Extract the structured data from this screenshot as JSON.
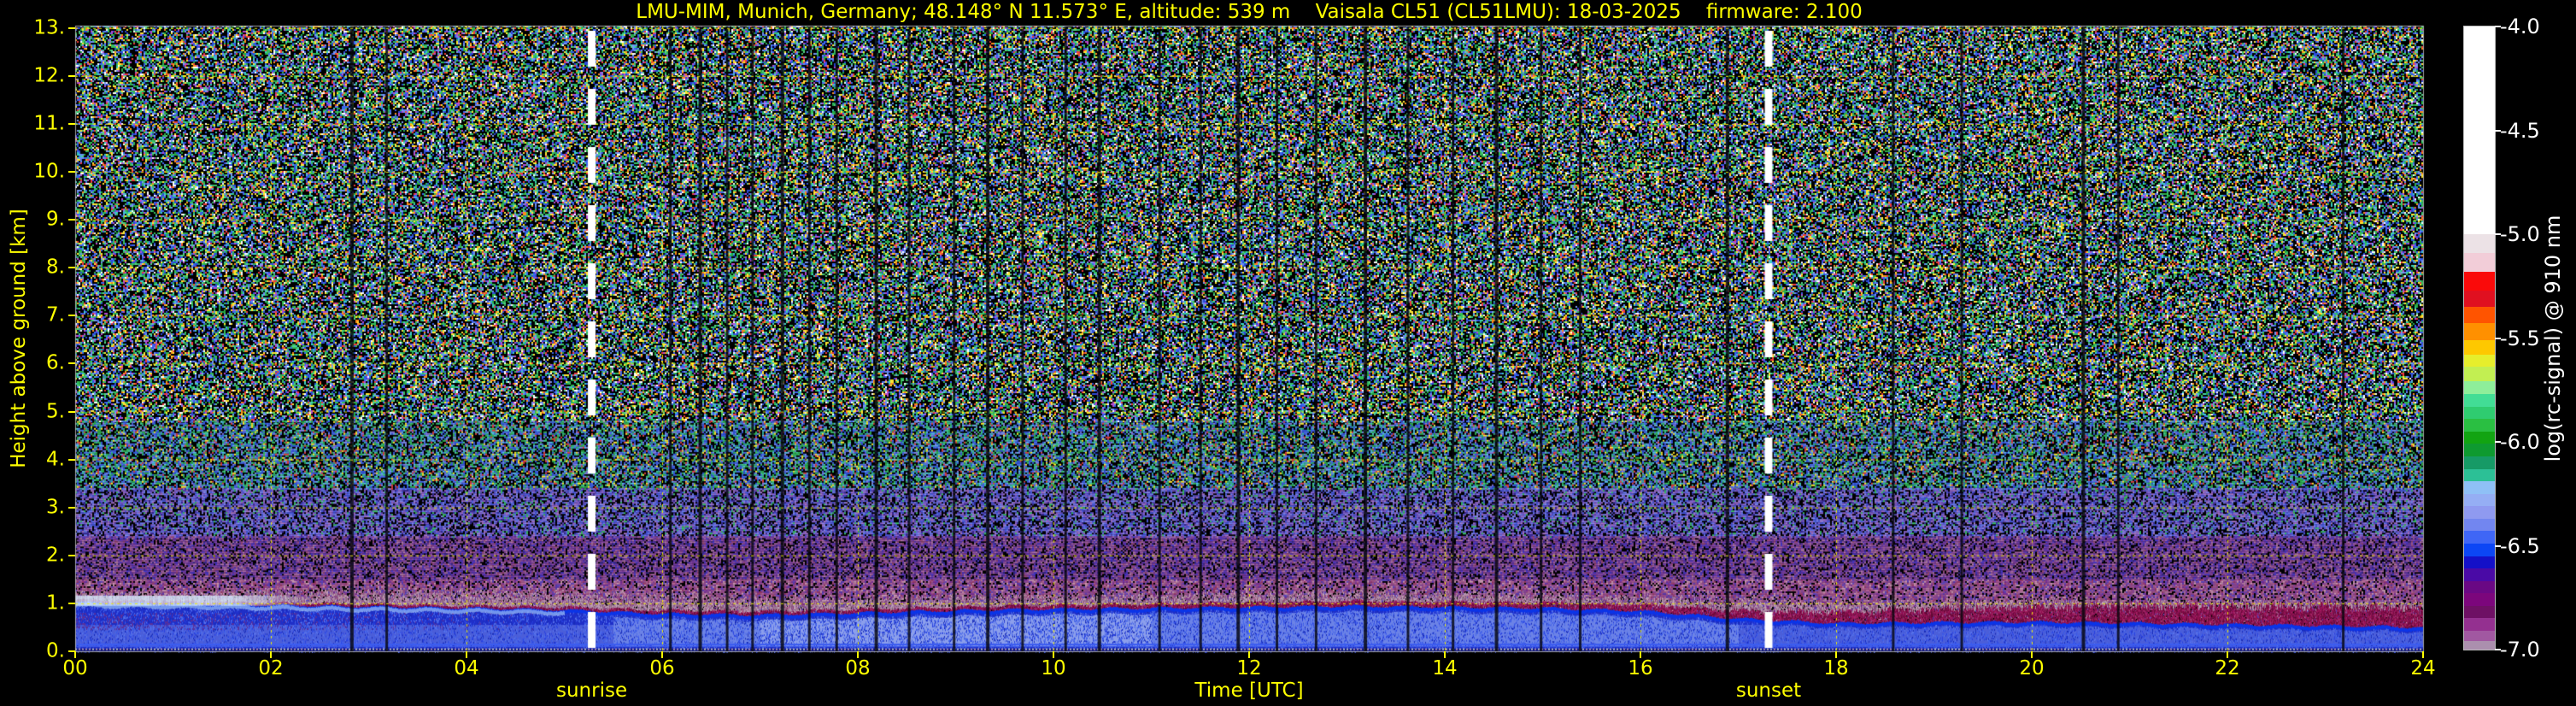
{
  "title": "LMU-MIM, Munich, Germany; 48.148° N 11.573° E, altitude: 539 m    Vaisala CL51 (CL51LMU): 18-03-2025    firmware: 2.100",
  "chart_data": {
    "type": "heatmap",
    "title": "LMU-MIM, Munich, Germany; 48.148° N 11.573° E, altitude: 539 m    Vaisala CL51 (CL51LMU): 18-03-2025    firmware: 2.100",
    "xlabel": "Time [UTC]",
    "ylabel": "Height above ground [km]",
    "colorbar_label": "log(rc-signal) @ 910 nm",
    "x_range_hours": [
      0,
      24
    ],
    "y_range_km": [
      0,
      13.05
    ],
    "x_tick_labels": [
      "00",
      "02",
      "04",
      "06",
      "08",
      "10",
      "12",
      "14",
      "16",
      "18",
      "20",
      "22",
      "24"
    ],
    "x_tick_values": [
      0,
      2,
      4,
      6,
      8,
      10,
      12,
      14,
      16,
      18,
      20,
      22,
      24
    ],
    "y_tick_labels": [
      "0.",
      "1.",
      "2.",
      "3.",
      "4.",
      "5.",
      "6.",
      "7.",
      "8.",
      "9.",
      "10.",
      "11.",
      "12.",
      "13."
    ],
    "y_tick_values": [
      0,
      1,
      2,
      3,
      4,
      5,
      6,
      7,
      8,
      9,
      10,
      11,
      12,
      13
    ],
    "grid": true,
    "gridline_color": "rgba(240,240,0,0.95)",
    "background_color": "#000000",
    "accent_color": "#ffff00",
    "sun_events": {
      "sunrise": {
        "hour": 5.28,
        "label": "sunrise"
      },
      "sunset": {
        "hour": 17.31,
        "label": "sunset"
      },
      "line_color": "#ffffff"
    },
    "colorbar": {
      "min": -7.0,
      "max": -4.0,
      "tick_labels": [
        "-4.0",
        "-4.5",
        "-5.0",
        "-5.5",
        "-6.0",
        "-6.5",
        "-7.0"
      ],
      "tick_values": [
        -4.0,
        -4.5,
        -5.0,
        -5.5,
        -6.0,
        -6.5,
        -7.0
      ],
      "bands": [
        {
          "v0": -4.0,
          "v1": -5.0,
          "color": "#ffffff"
        },
        {
          "v0": -5.0,
          "v1": -5.09,
          "color": "#ece2e6"
        },
        {
          "v0": -5.09,
          "v1": -5.18,
          "color": "#f2cdd8"
        },
        {
          "v0": -5.18,
          "v1": -5.27,
          "color": "#fa0a0a"
        },
        {
          "v0": -5.27,
          "v1": -5.35,
          "color": "#e01020"
        },
        {
          "v0": -5.35,
          "v1": -5.43,
          "color": "#ff5400"
        },
        {
          "v0": -5.43,
          "v1": -5.51,
          "color": "#ff9000"
        },
        {
          "v0": -5.51,
          "v1": -5.58,
          "color": "#fec800"
        },
        {
          "v0": -5.58,
          "v1": -5.64,
          "color": "#e6ee2c"
        },
        {
          "v0": -5.64,
          "v1": -5.71,
          "color": "#c2ef52"
        },
        {
          "v0": -5.71,
          "v1": -5.77,
          "color": "#8eee9a"
        },
        {
          "v0": -5.77,
          "v1": -5.83,
          "color": "#42dd95"
        },
        {
          "v0": -5.83,
          "v1": -5.89,
          "color": "#2fcc70"
        },
        {
          "v0": -5.89,
          "v1": -5.95,
          "color": "#2abf42"
        },
        {
          "v0": -5.95,
          "v1": -6.01,
          "color": "#12a412"
        },
        {
          "v0": -6.01,
          "v1": -6.07,
          "color": "#0e9a30"
        },
        {
          "v0": -6.07,
          "v1": -6.13,
          "color": "#169a66"
        },
        {
          "v0": -6.13,
          "v1": -6.19,
          "color": "#2cc096"
        },
        {
          "v0": -6.19,
          "v1": -6.25,
          "color": "#8fc0f6"
        },
        {
          "v0": -6.25,
          "v1": -6.31,
          "color": "#95aef4"
        },
        {
          "v0": -6.31,
          "v1": -6.37,
          "color": "#8f9af0"
        },
        {
          "v0": -6.37,
          "v1": -6.43,
          "color": "#7286f0"
        },
        {
          "v0": -6.43,
          "v1": -6.49,
          "color": "#3f66f6"
        },
        {
          "v0": -6.49,
          "v1": -6.55,
          "color": "#0c46f5"
        },
        {
          "v0": -6.55,
          "v1": -6.61,
          "color": "#1410c8"
        },
        {
          "v0": -6.61,
          "v1": -6.67,
          "color": "#4a0aa6"
        },
        {
          "v0": -6.67,
          "v1": -6.73,
          "color": "#6a0884"
        },
        {
          "v0": -6.73,
          "v1": -6.79,
          "color": "#7c067c"
        },
        {
          "v0": -6.79,
          "v1": -6.85,
          "color": "#6e1064"
        },
        {
          "v0": -6.85,
          "v1": -6.91,
          "color": "#943090"
        },
        {
          "v0": -6.91,
          "v1": -6.96,
          "color": "#a158a1"
        },
        {
          "v0": -6.96,
          "v1": -7.0,
          "color": "#ab8fae"
        }
      ]
    },
    "noise_bands": [
      {
        "top_km": 13.05,
        "bottom_km": 4.8,
        "density": 0.6,
        "palette": [
          "#2b49d8",
          "#3b63ee",
          "#6a8cf2",
          "#22a844",
          "#35c258",
          "#57d08a",
          "#ffe633",
          "#ff8c1a",
          "#f03a3a",
          "#b84ad0",
          "#39cfc4",
          "#ffffff",
          "#3b63ee",
          "#2fae4e",
          "#7a9af2",
          "#ffe633",
          "#2b49d8",
          "#34bf66"
        ]
      },
      {
        "top_km": 4.8,
        "bottom_km": 3.4,
        "density": 0.66,
        "palette": [
          "#3458e0",
          "#4a6cee",
          "#7a92f0",
          "#2fae4e",
          "#3cc06a",
          "#45cf9a",
          "#8a7ae0",
          "#ffe633",
          "#e04040",
          "#3458e0",
          "#57c0ee",
          "#2fae4e",
          "#4a6cee",
          "#35b0a0"
        ]
      },
      {
        "top_km": 3.4,
        "bottom_km": 2.4,
        "density": 0.7,
        "palette": [
          "#4a5ae0",
          "#6a7aee",
          "#8a8af0",
          "#5a4ab8",
          "#7a5ac8",
          "#9a6ac8",
          "#3cc06a",
          "#4a5ae0",
          "#6a7aee",
          "#8868d8",
          "#aa78c8",
          "#3a2a9a"
        ]
      },
      {
        "top_km": 2.4,
        "bottom_km": 1.5,
        "density": 0.78,
        "palette": [
          "#6a3aa8",
          "#8a4aa8",
          "#7a3a98",
          "#5a3ac0",
          "#9a5a9a",
          "#4a3ad0",
          "#aa6aaa",
          "#8a4aa8",
          "#b07aa8",
          "#6a3aa8",
          "#3a2a8a",
          "#9a4a7a"
        ]
      },
      {
        "top_km": 1.5,
        "bottom_km": 0.3,
        "density": 0.84,
        "palette": [
          "#8a4898",
          "#a05888",
          "#b078a0",
          "#9a3a6a",
          "#7a2f9a",
          "#6048c0",
          "#c898b0",
          "#8a4898",
          "#a05888",
          "#5a3ab0",
          "#b8689a",
          "#984a88"
        ]
      }
    ],
    "layers": {
      "hours": [
        0,
        1,
        2,
        3,
        4,
        5,
        6,
        7,
        8,
        9,
        10,
        11,
        12,
        13,
        14,
        15,
        16,
        17,
        18,
        19,
        20,
        21,
        22,
        23,
        24
      ],
      "bl_top_km": [
        1.02,
        0.99,
        0.96,
        0.93,
        0.9,
        0.86,
        0.78,
        0.76,
        0.8,
        0.85,
        0.88,
        0.9,
        0.92,
        0.94,
        0.92,
        0.9,
        0.84,
        0.68,
        0.58,
        0.6,
        0.61,
        0.59,
        0.56,
        0.53,
        0.5
      ],
      "cap_thickness_km": [
        0.05,
        0.05,
        0.05,
        0.05,
        0.05,
        0.06,
        0.07,
        0.07,
        0.07,
        0.07,
        0.08,
        0.08,
        0.09,
        0.1,
        0.1,
        0.11,
        0.13,
        0.17,
        0.22,
        0.27,
        0.31,
        0.34,
        0.37,
        0.39,
        0.41
      ],
      "haze_top_km": [
        1.28,
        1.27,
        1.3,
        1.33,
        1.31,
        1.28,
        1.22,
        1.16,
        1.15,
        1.18,
        1.21,
        1.23,
        1.26,
        1.28,
        1.26,
        1.22,
        1.18,
        1.12,
        1.06,
        1.08,
        1.1,
        1.1,
        1.09,
        1.07,
        1.05
      ]
    },
    "residual_layer": {
      "start_hour": 0,
      "end_hour": 2.4,
      "top_km": 1.16,
      "bottom_km": 0.95,
      "color": "#d4e6fa"
    },
    "bl_colors": {
      "base": "#1f2fc8",
      "deep_edge": "#0a34e8",
      "light": "#8098ee",
      "lighter": "#a8bcf4",
      "speckle": [
        "#2840e0",
        "#3858e8",
        "#182cb8",
        "#4868e8",
        "#5a74ec"
      ],
      "purple_patch": "#5a2f9a",
      "morning_band": "#9ec0f2",
      "bottom_dark": "#0d1166",
      "bottom_line": "#3c5cf0",
      "bottom_dots": [
        "#c0c0c8",
        "#b090b8"
      ],
      "cap": [
        "#8a0a4a",
        "#9a1256",
        "#760a40",
        "#a52062",
        "#670a38"
      ],
      "haze": [
        "#b89ab0",
        "#c4a8bc",
        "#a8889c",
        "#9a7a90",
        "#8a5a80"
      ]
    },
    "gap_streaks_hours": [
      2.82,
      3.18,
      6.08,
      6.38,
      6.66,
      6.92,
      7.22,
      7.5,
      7.78,
      8.18,
      8.52,
      8.98,
      9.32,
      9.68,
      10.12,
      10.46,
      11.08,
      11.5,
      11.88,
      12.28,
      12.68,
      13.18,
      13.62,
      14.08,
      14.52,
      14.98,
      15.38,
      16.88,
      18.58,
      19.28,
      20.52,
      20.88,
      23.18
    ]
  }
}
